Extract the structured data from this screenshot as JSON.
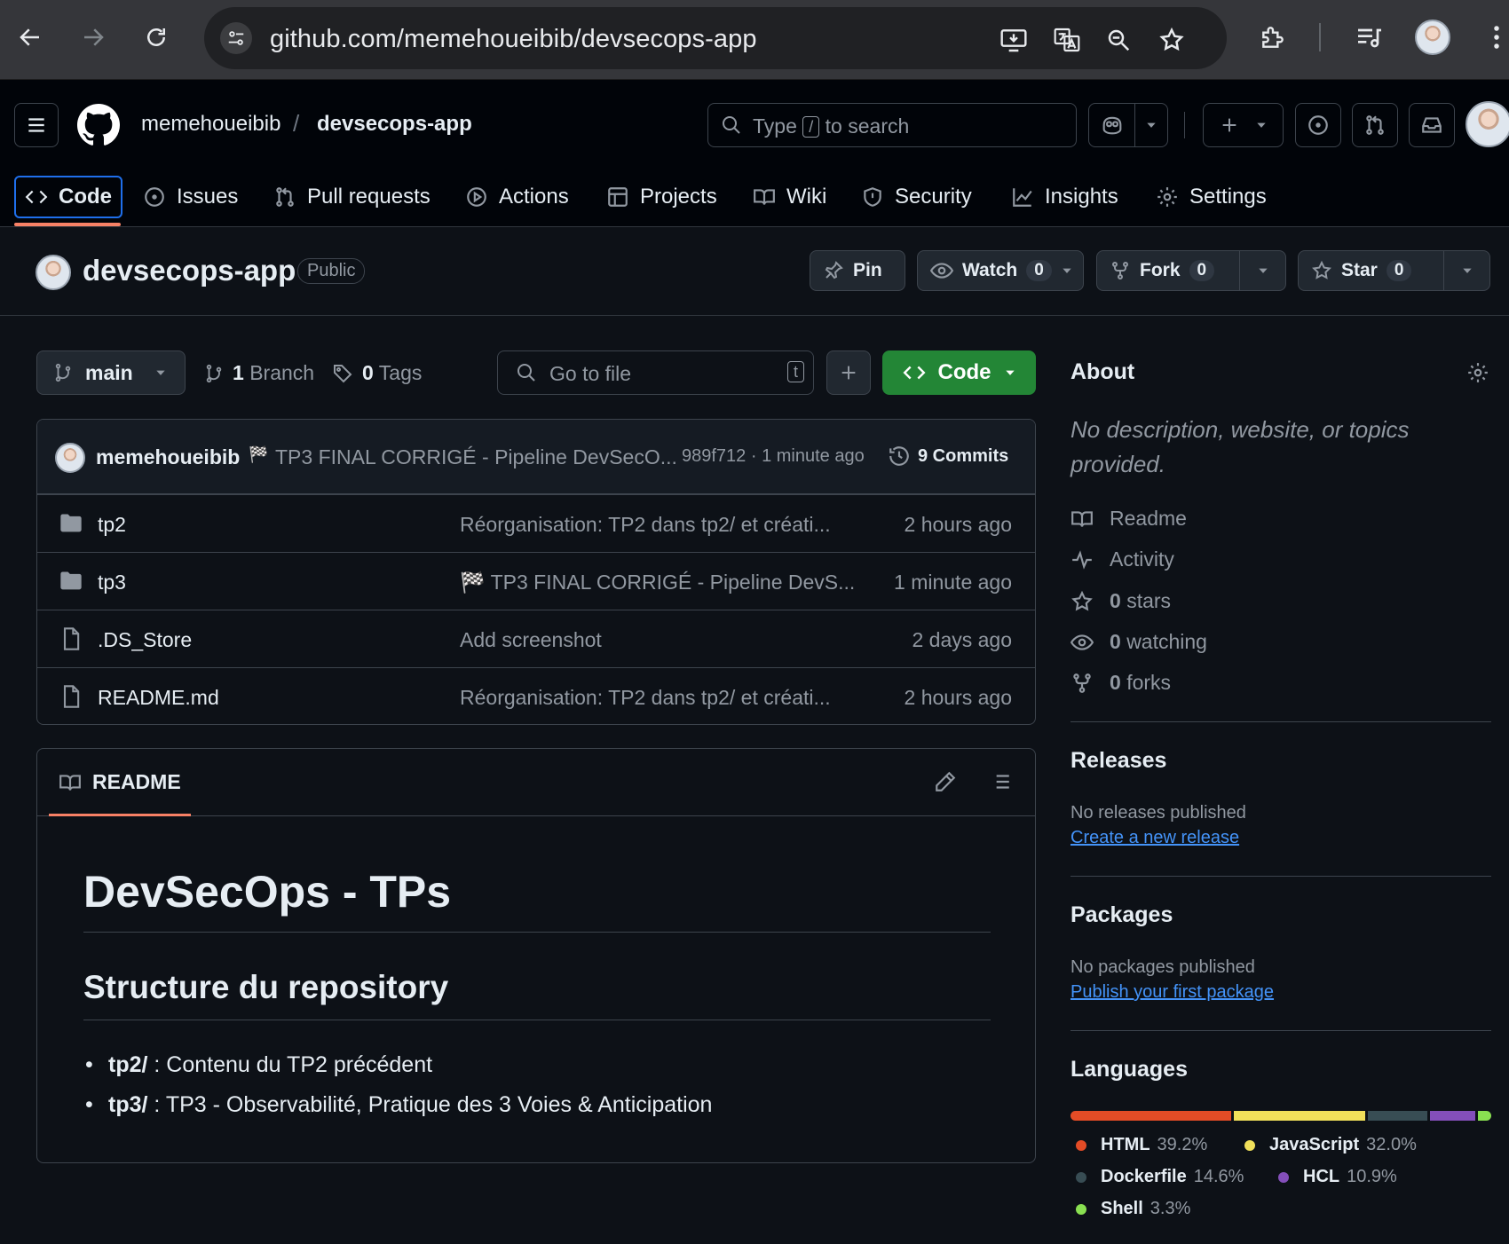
{
  "browser": {
    "url": "github.com/memehoueibib/devsecops-app"
  },
  "header": {
    "owner": "memehoueibib",
    "separator": "/",
    "repo": "devsecops-app",
    "search": {
      "prefix": "Type",
      "key": "/",
      "suffix": "to search"
    }
  },
  "tabs": [
    {
      "label": "Code",
      "icon": "code-icon"
    },
    {
      "label": "Issues",
      "icon": "issue-icon"
    },
    {
      "label": "Pull requests",
      "icon": "pull-request-icon"
    },
    {
      "label": "Actions",
      "icon": "play-icon"
    },
    {
      "label": "Projects",
      "icon": "table-icon"
    },
    {
      "label": "Wiki",
      "icon": "book-icon"
    },
    {
      "label": "Security",
      "icon": "shield-icon"
    },
    {
      "label": "Insights",
      "icon": "graph-icon"
    },
    {
      "label": "Settings",
      "icon": "gear-icon"
    }
  ],
  "repo": {
    "title": "devsecops-app",
    "visibility": "Public",
    "pin_label": "Pin",
    "watch_label": "Watch",
    "watch_count": "0",
    "fork_label": "Fork",
    "fork_count": "0",
    "star_label": "Star",
    "star_count": "0"
  },
  "toolbar": {
    "branch": "main",
    "branch_count": "1",
    "branch_label": "Branch",
    "tag_count": "0",
    "tag_label": "Tags",
    "goto_placeholder": "Go to file",
    "goto_key": "t",
    "code_label": "Code"
  },
  "commit": {
    "author": "memehoueibib",
    "emoji": "🏁",
    "message": "TP3 FINAL CORRIGÉ - Pipeline DevSecO...",
    "hash": "989f712",
    "dot": "·",
    "time": "1 minute ago",
    "count_label": "9 Commits"
  },
  "files": [
    {
      "name": "tp2",
      "type": "folder",
      "message": "Réorganisation: TP2 dans tp2/ et créati...",
      "time": "2 hours ago"
    },
    {
      "name": "tp3",
      "type": "folder",
      "message": "🏁 TP3 FINAL CORRIGÉ - Pipeline DevS...",
      "time": "1 minute ago"
    },
    {
      "name": ".DS_Store",
      "type": "file",
      "message": "Add screenshot",
      "time": "2 days ago"
    },
    {
      "name": "README.md",
      "type": "file",
      "message": "Réorganisation: TP2 dans tp2/ et créati...",
      "time": "2 hours ago"
    }
  ],
  "readme": {
    "tab_label": "README",
    "h1": "DevSecOps - TPs",
    "h2": "Structure du repository",
    "items": [
      {
        "bold": "tp2/",
        "text": " : Contenu du TP2 précédent"
      },
      {
        "bold": "tp3/",
        "text": " : TP3 - Observabilité, Pratique des 3 Voies & Anticipation"
      }
    ]
  },
  "sidebar": {
    "about_title": "About",
    "description": "No description, website, or topics provided.",
    "items": [
      {
        "icon": "book-icon",
        "count": "",
        "label": "Readme"
      },
      {
        "icon": "pulse-icon",
        "count": "",
        "label": "Activity"
      },
      {
        "icon": "star-icon",
        "count": "0",
        "label": "stars"
      },
      {
        "icon": "eye-icon",
        "count": "0",
        "label": "watching"
      },
      {
        "icon": "fork-icon",
        "count": "0",
        "label": "forks"
      }
    ],
    "releases_title": "Releases",
    "releases_empty": "No releases published",
    "releases_link": "Create a new release",
    "packages_title": "Packages",
    "packages_empty": "No packages published",
    "packages_link": "Publish your first package",
    "languages_title": "Languages",
    "languages": [
      {
        "name": "HTML",
        "percent": "39.2%",
        "value": 39.2,
        "color": "#e34c26"
      },
      {
        "name": "JavaScript",
        "percent": "32.0%",
        "value": 32.0,
        "color": "#f1e05a"
      },
      {
        "name": "Dockerfile",
        "percent": "14.6%",
        "value": 14.6,
        "color": "#384d54"
      },
      {
        "name": "HCL",
        "percent": "10.9%",
        "value": 10.9,
        "color": "#844fba"
      },
      {
        "name": "Shell",
        "percent": "3.3%",
        "value": 3.3,
        "color": "#89e051"
      }
    ]
  }
}
